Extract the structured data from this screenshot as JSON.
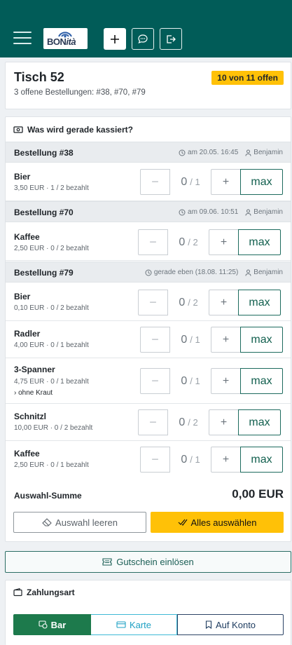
{
  "header": {
    "logo_text": "BON",
    "logo_text_ita": "ità",
    "buttons": [
      "menu-icon",
      "plus-icon",
      "chat-icon",
      "logout-icon"
    ]
  },
  "table": {
    "title": "Tisch 52",
    "subtitle": "3 offene Bestellungen: #38, #70, #79",
    "badge": "10 von 11 offen"
  },
  "checkout": {
    "heading": "Was wird gerade kassiert?",
    "orders": [
      {
        "title": "Bestellung #38",
        "time": "am 20.05. 16:45",
        "user": "Benjamin"
      },
      {
        "title": "Bestellung #70",
        "time": "am 09.06. 10:51",
        "user": "Benjamin"
      },
      {
        "title": "Bestellung #79",
        "time": "gerade eben (18.08. 11:25)",
        "user": "Benjamin"
      }
    ],
    "items": [
      {
        "name": "Bier",
        "sub": "3,50 EUR · 1 / 2 bezahlt",
        "qty": "0",
        "total": "/ 1"
      },
      {
        "name": "Kaffee",
        "sub": "2,50 EUR · 0 / 2 bezahlt",
        "qty": "0",
        "total": "/ 2"
      },
      {
        "name": "Bier",
        "sub": "0,10 EUR · 0 / 2 bezahlt",
        "qty": "0",
        "total": "/ 2"
      },
      {
        "name": "Radler",
        "sub": "4,00 EUR · 0 / 1 bezahlt",
        "qty": "0",
        "total": "/ 1"
      },
      {
        "name": "3-Spanner",
        "sub": "4,75 EUR · 0 / 1 bezahlt",
        "note": "› ohne Kraut",
        "qty": "0",
        "total": "/ 1"
      },
      {
        "name": "Schnitzl",
        "sub": "10,00 EUR · 0 / 2 bezahlt",
        "qty": "0",
        "total": "/ 2"
      },
      {
        "name": "Kaffee",
        "sub": "2,50 EUR · 0 / 1 bezahlt",
        "qty": "0",
        "total": "/ 1"
      }
    ],
    "stepper": {
      "minus": "−",
      "plus": "+",
      "max": "max"
    },
    "sum_label": "Auswahl-Summe",
    "sum_value": "0,00 EUR",
    "clear_label": "Auswahl leeren",
    "select_all_label": "Alles auswählen"
  },
  "voucher_label": "Gutschein einlösen",
  "payment": {
    "heading": "Zahlungsart",
    "options": [
      "Bar",
      "Karte",
      "Auf Konto"
    ],
    "selected": "Bar"
  },
  "colors": {
    "topbar": "#015c58",
    "badge": "#ffc107",
    "max_border": "#1d6b5e",
    "pay_bar": "#1d7a4c",
    "pay_karte": "#3fb9d6",
    "pay_konto": "#2c4466"
  }
}
